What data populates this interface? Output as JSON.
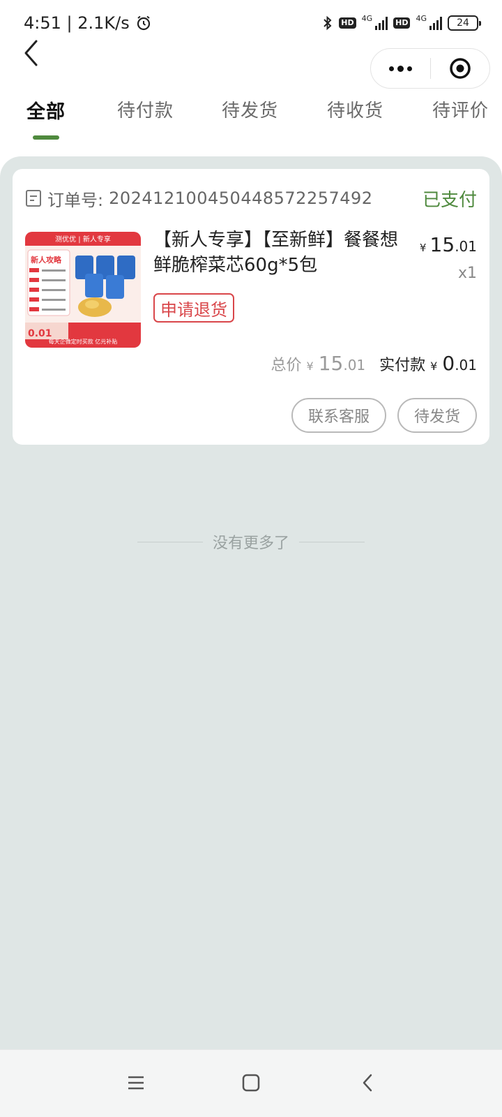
{
  "status_bar": {
    "time": "4:51",
    "speed": "2.1K/s",
    "battery": "24",
    "net1": "4G",
    "net2": "4G",
    "hd1": "HD",
    "hd2": "HD"
  },
  "tabs": [
    {
      "label": "全部",
      "active": true
    },
    {
      "label": "待付款",
      "active": false
    },
    {
      "label": "待发货",
      "active": false
    },
    {
      "label": "待收货",
      "active": false
    },
    {
      "label": "待评价",
      "active": false
    }
  ],
  "order": {
    "order_no_label": "订单号:",
    "order_no": "20241210045044857225749​2",
    "status": "已支付",
    "product_title": "【新人专享】【至新鲜】餐餐想鲜脆榨菜芯60g*5包",
    "price_yen": "¥",
    "price_int": "15",
    "price_dec": ".01",
    "quantity": "x1",
    "refund_label": "申请退货",
    "total_label": "总价",
    "total_yen": "¥",
    "total_int": "15",
    "total_dec": ".01",
    "paid_label": "实付款",
    "paid_yen": "¥",
    "paid_int": "0",
    "paid_dec": ".01",
    "actions": {
      "contact": "联系客服",
      "pending_ship": "待发货"
    },
    "image_text": {
      "banner": "测优优 | 新人专享",
      "title": "新人攻略",
      "price": "0.01",
      "footer": "每天企微定时买款  亿元补贴"
    }
  },
  "footer_text": "没有更多了",
  "colors": {
    "accent": "#4f8a3e",
    "refund_red": "#d9464a",
    "page_bg": "#dfe6e5"
  }
}
